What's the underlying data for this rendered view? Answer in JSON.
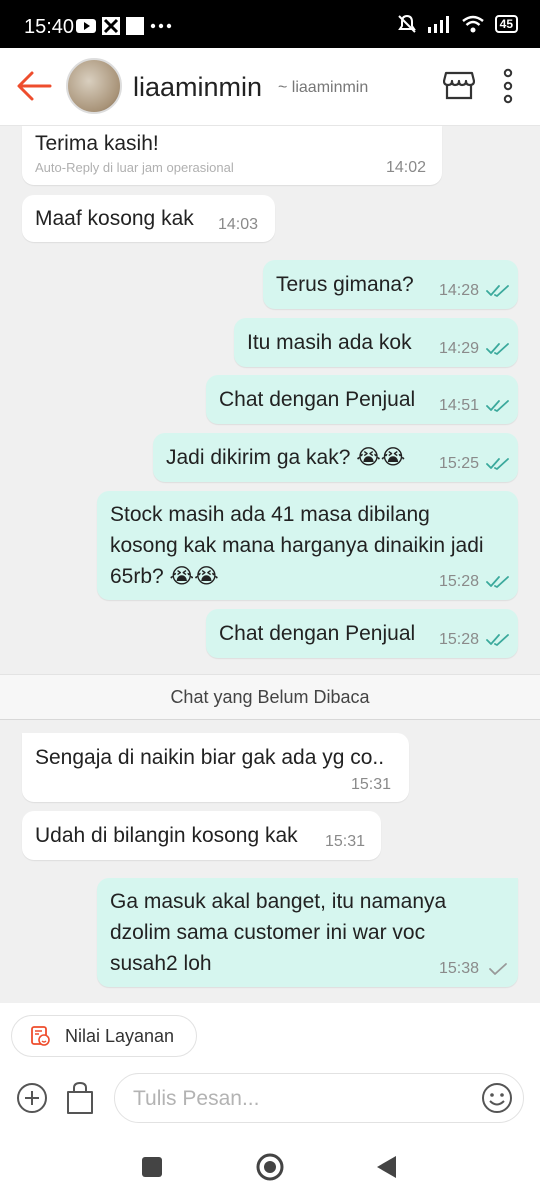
{
  "status_bar": {
    "time": "15:40",
    "battery": "45"
  },
  "header": {
    "name": "liaaminmin",
    "username": "~ liaaminmin"
  },
  "messages": [
    {
      "text": "Terima kasih!",
      "sub": "Auto-Reply di luar jam operasional",
      "time": "14:02"
    },
    {
      "text": "Maaf kosong kak",
      "time": "14:03"
    },
    {
      "text": "Terus gimana?",
      "time": "14:28"
    },
    {
      "text": "Itu masih ada kok",
      "time": "14:29"
    },
    {
      "text": "Chat dengan Penjual",
      "time": "14:51"
    },
    {
      "text": "Jadi dikirim ga kak? 😭😭",
      "time": "15:25"
    },
    {
      "lines": [
        "Stock masih ada 41 masa dibilang",
        "kosong kak mana harganya dinaikin jadi",
        "65rb? 😭😭"
      ],
      "time": "15:28"
    },
    {
      "text": "Chat dengan Penjual",
      "time": "15:28"
    },
    {
      "text": "Sengaja di naikin biar gak ada yg co..",
      "time": "15:31"
    },
    {
      "text": "Udah di bilangin kosong kak",
      "time": "15:31"
    },
    {
      "lines": [
        "Ga masuk akal banget, itu namanya",
        "dzolim sama customer ini war voc",
        "susah2 loh"
      ],
      "time": "15:38"
    }
  ],
  "divider": "Chat yang Belum Dibaca",
  "bottom": {
    "rating_label": "Nilai Layanan",
    "input_placeholder": "Tulis Pesan..."
  },
  "colors": {
    "accent": "#ee4d2d",
    "outgoing_bubble": "#d6f6ef",
    "read_tick": "#3ba99c"
  }
}
